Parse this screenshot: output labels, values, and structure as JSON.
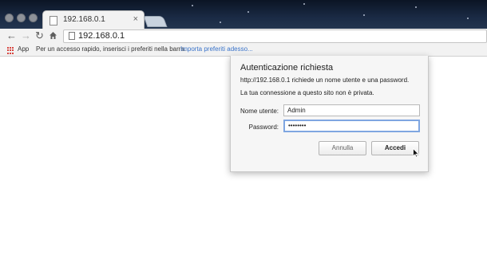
{
  "browser": {
    "tab": {
      "title": "192.168.0.1",
      "close_glyph": "×"
    },
    "toolbar": {
      "back_icon": "back-arrow-icon",
      "forward_icon": "forward-arrow-icon",
      "reload_icon": "reload-icon",
      "home_icon": "home-icon",
      "address": "192.168.0.1"
    },
    "bookmarks": {
      "apps_label": "App",
      "hint": "Per un accesso rapido, inserisci i preferiti nella barra.",
      "import_link": "Importa preferiti adesso..."
    }
  },
  "auth_dialog": {
    "title": "Autenticazione richiesta",
    "message": "http://192.168.0.1 richiede un nome utente e una password.",
    "privacy_note": "La tua connessione a questo sito non è privata.",
    "username_label": "Nome utente:",
    "username_value": "Admin",
    "password_label": "Password:",
    "password_value": "••••••••",
    "cancel_label": "Annulla",
    "login_label": "Accedi"
  },
  "colors": {
    "link": "#3a73c9",
    "focus_ring": "#7fa6e1",
    "window_bg": "#f2f2f2"
  }
}
